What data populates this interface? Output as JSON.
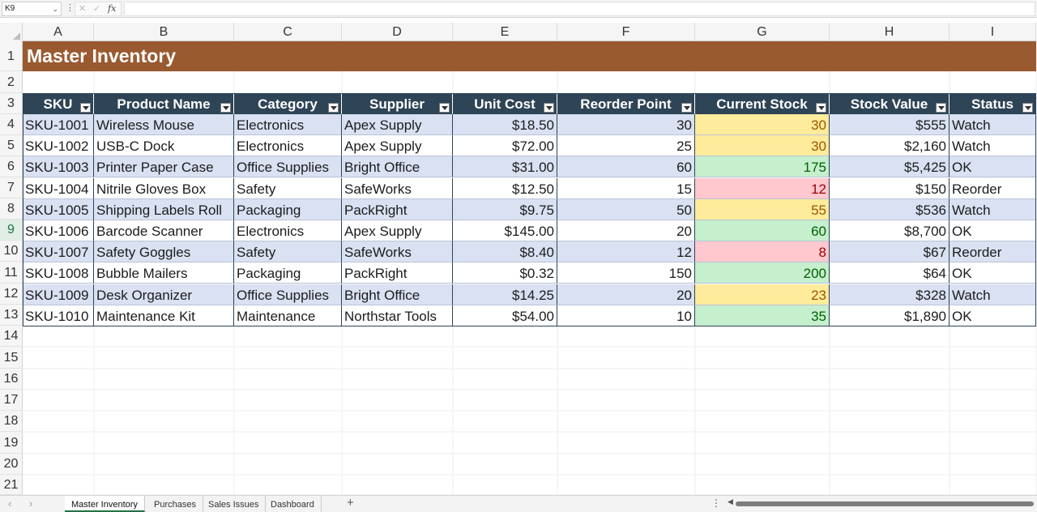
{
  "formula_bar": {
    "name_box": "K9",
    "fx_label": "fx",
    "formula": ""
  },
  "columns": [
    "A",
    "B",
    "C",
    "D",
    "E",
    "F",
    "G",
    "H",
    "I"
  ],
  "rows": [
    "1",
    "2",
    "3",
    "4",
    "5",
    "6",
    "7",
    "8",
    "9",
    "10",
    "11",
    "12",
    "13",
    "14",
    "15",
    "16",
    "17",
    "18",
    "19",
    "20",
    "21"
  ],
  "active_row": "9",
  "title": "Master Inventory",
  "table": {
    "headers": [
      "SKU",
      "Product Name",
      "Category",
      "Supplier",
      "Unit Cost",
      "Reorder Point",
      "Current Stock",
      "Stock Value",
      "Status"
    ],
    "rows": [
      {
        "sku": "SKU-1001",
        "name": "Wireless Mouse",
        "category": "Electronics",
        "supplier": "Apex Supply",
        "unit_cost": "$18.50",
        "reorder": "30",
        "stock": "30",
        "value": "$555",
        "status": "Watch"
      },
      {
        "sku": "SKU-1002",
        "name": "USB-C Dock",
        "category": "Electronics",
        "supplier": "Apex Supply",
        "unit_cost": "$72.00",
        "reorder": "25",
        "stock": "30",
        "value": "$2,160",
        "status": "Watch"
      },
      {
        "sku": "SKU-1003",
        "name": "Printer Paper Case",
        "category": "Office Supplies",
        "supplier": "Bright Office",
        "unit_cost": "$31.00",
        "reorder": "60",
        "stock": "175",
        "value": "$5,425",
        "status": "OK"
      },
      {
        "sku": "SKU-1004",
        "name": "Nitrile Gloves Box",
        "category": "Safety",
        "supplier": "SafeWorks",
        "unit_cost": "$12.50",
        "reorder": "15",
        "stock": "12",
        "value": "$150",
        "status": "Reorder"
      },
      {
        "sku": "SKU-1005",
        "name": "Shipping Labels Roll",
        "category": "Packaging",
        "supplier": "PackRight",
        "unit_cost": "$9.75",
        "reorder": "50",
        "stock": "55",
        "value": "$536",
        "status": "Watch"
      },
      {
        "sku": "SKU-1006",
        "name": "Barcode Scanner",
        "category": "Electronics",
        "supplier": "Apex Supply",
        "unit_cost": "$145.00",
        "reorder": "20",
        "stock": "60",
        "value": "$8,700",
        "status": "OK"
      },
      {
        "sku": "SKU-1007",
        "name": "Safety Goggles",
        "category": "Safety",
        "supplier": "SafeWorks",
        "unit_cost": "$8.40",
        "reorder": "12",
        "stock": "8",
        "value": "$67",
        "status": "Reorder"
      },
      {
        "sku": "SKU-1008",
        "name": "Bubble Mailers",
        "category": "Packaging",
        "supplier": "PackRight",
        "unit_cost": "$0.32",
        "reorder": "150",
        "stock": "200",
        "value": "$64",
        "status": "OK"
      },
      {
        "sku": "SKU-1009",
        "name": "Desk Organizer",
        "category": "Office Supplies",
        "supplier": "Bright Office",
        "unit_cost": "$14.25",
        "reorder": "20",
        "stock": "23",
        "value": "$328",
        "status": "Watch"
      },
      {
        "sku": "SKU-1010",
        "name": "Maintenance Kit",
        "category": "Maintenance",
        "supplier": "Northstar Tools",
        "unit_cost": "$54.00",
        "reorder": "10",
        "stock": "35",
        "value": "$1,890",
        "status": "OK"
      }
    ]
  },
  "sheets": {
    "tabs": [
      "Master Inventory",
      "Purchases",
      "Sales Issues",
      "Dashboard"
    ],
    "active": "Master Inventory",
    "add_label": "+"
  },
  "colors": {
    "title_bg": "#9a5a30",
    "header_bg": "#2e4457",
    "band_bg": "#d9e1f2",
    "ok_bg": "#c6efce",
    "ok_fg": "#006100",
    "watch_bg": "#ffeb9c",
    "watch_fg": "#9c5700",
    "reorder_bg": "#ffc7ce",
    "reorder_fg": "#9c0006"
  }
}
